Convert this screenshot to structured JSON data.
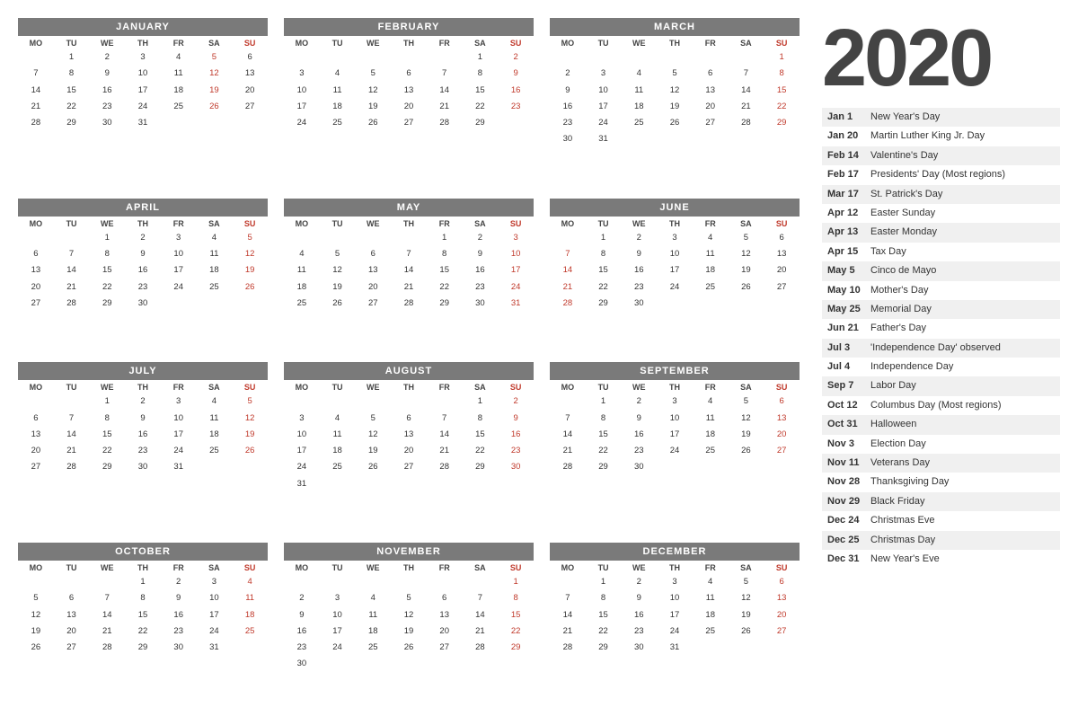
{
  "year": "2020",
  "months": [
    {
      "name": "JANUARY",
      "startDay": 2,
      "days": 31,
      "sundays": [
        5,
        12,
        19,
        26
      ]
    },
    {
      "name": "FEBRUARY",
      "startDay": 6,
      "days": 29,
      "sundays": [
        2,
        9,
        16,
        23
      ]
    },
    {
      "name": "MARCH",
      "startDay": 7,
      "days": 31,
      "sundays": [
        1,
        8,
        15,
        22,
        29
      ]
    },
    {
      "name": "APRIL",
      "startDay": 3,
      "days": 30,
      "sundays": [
        5,
        12,
        19,
        26
      ]
    },
    {
      "name": "MAY",
      "startDay": 5,
      "days": 31,
      "sundays": [
        3,
        10,
        17,
        24,
        31
      ]
    },
    {
      "name": "JUNE",
      "startDay": 2,
      "days": 30,
      "sundays": [
        7,
        14,
        21,
        28
      ]
    },
    {
      "name": "JULY",
      "startDay": 3,
      "days": 31,
      "sundays": [
        5,
        12,
        19,
        26
      ]
    },
    {
      "name": "AUGUST",
      "startDay": 6,
      "days": 31,
      "sundays": [
        2,
        9,
        16,
        23,
        30
      ]
    },
    {
      "name": "SEPTEMBER",
      "startDay": 2,
      "days": 30,
      "sundays": [
        6,
        13,
        20,
        27
      ]
    },
    {
      "name": "OCTOBER",
      "startDay": 4,
      "days": 31,
      "sundays": [
        4,
        11,
        18,
        25
      ]
    },
    {
      "name": "NOVEMBER",
      "startDay": 7,
      "days": 30,
      "sundays": [
        1,
        8,
        15,
        22,
        29
      ]
    },
    {
      "name": "DECEMBER",
      "startDay": 2,
      "days": 31,
      "sundays": [
        6,
        13,
        20,
        27
      ]
    }
  ],
  "dayHeaders": [
    "MO",
    "TU",
    "WE",
    "TH",
    "FR",
    "SA",
    "SU"
  ],
  "holidays": [
    {
      "date": "Jan 1",
      "name": "New Year's Day"
    },
    {
      "date": "Jan 20",
      "name": "Martin Luther King Jr. Day"
    },
    {
      "date": "Feb 14",
      "name": "Valentine's Day"
    },
    {
      "date": "Feb 17",
      "name": "Presidents' Day (Most regions)"
    },
    {
      "date": "Mar 17",
      "name": "St. Patrick's Day"
    },
    {
      "date": "Apr 12",
      "name": "Easter Sunday"
    },
    {
      "date": "Apr 13",
      "name": "Easter Monday"
    },
    {
      "date": "Apr 15",
      "name": "Tax Day"
    },
    {
      "date": "May 5",
      "name": "Cinco de Mayo"
    },
    {
      "date": "May 10",
      "name": "Mother's Day"
    },
    {
      "date": "May 25",
      "name": "Memorial Day"
    },
    {
      "date": "Jun 21",
      "name": "Father's Day"
    },
    {
      "date": "Jul 3",
      "name": "'Independence Day' observed"
    },
    {
      "date": "Jul 4",
      "name": "Independence Day"
    },
    {
      "date": "Sep 7",
      "name": "Labor Day"
    },
    {
      "date": "Oct 12",
      "name": "Columbus Day (Most regions)"
    },
    {
      "date": "Oct 31",
      "name": "Halloween"
    },
    {
      "date": "Nov 3",
      "name": "Election Day"
    },
    {
      "date": "Nov 11",
      "name": "Veterans Day"
    },
    {
      "date": "Nov 28",
      "name": "Thanksgiving Day"
    },
    {
      "date": "Nov 29",
      "name": "Black Friday"
    },
    {
      "date": "Dec 24",
      "name": "Christmas Eve"
    },
    {
      "date": "Dec 25",
      "name": "Christmas Day"
    },
    {
      "date": "Dec 31",
      "name": "New Year's Eve"
    }
  ]
}
